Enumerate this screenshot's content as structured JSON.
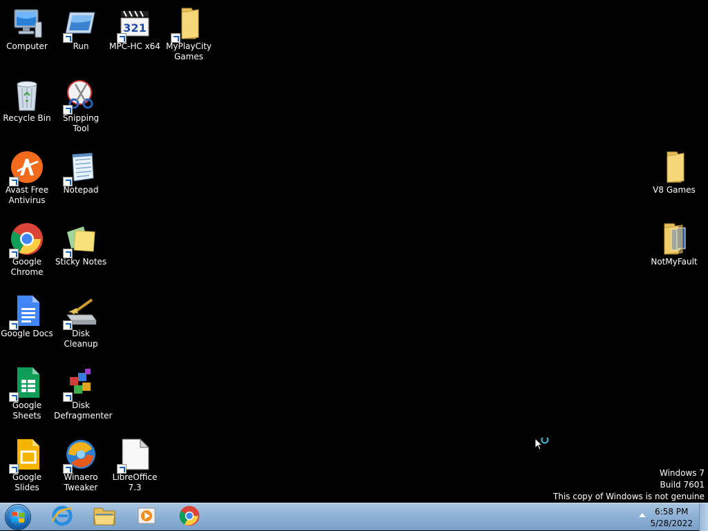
{
  "desktop": {
    "icons": [
      {
        "label": "Computer"
      },
      {
        "label": "Run"
      },
      {
        "label": "MPC-HC x64"
      },
      {
        "label": "MyPlayCity Games"
      },
      {
        "label": "Recycle Bin"
      },
      {
        "label": "Snipping Tool"
      },
      {
        "label": "Avast Free Antivirus"
      },
      {
        "label": "Notepad"
      },
      {
        "label": "Google Chrome"
      },
      {
        "label": "Sticky Notes"
      },
      {
        "label": "Google Docs"
      },
      {
        "label": "Disk Cleanup"
      },
      {
        "label": "Google Sheets"
      },
      {
        "label": "Disk Defragmenter"
      },
      {
        "label": "Google Slides"
      },
      {
        "label": "Winaero Tweaker"
      },
      {
        "label": "LibreOffice 7.3"
      },
      {
        "label": "V8 Games"
      },
      {
        "label": "NotMyFault"
      }
    ]
  },
  "watermark": {
    "line1": "Windows 7",
    "line2": "Build 7601",
    "line3": "This copy of Windows is not genuine"
  },
  "taskbar": {
    "pinned": [
      {
        "icon": "internet-explorer-icon"
      },
      {
        "icon": "windows-explorer-icon"
      },
      {
        "icon": "windows-media-player-icon"
      },
      {
        "icon": "google-chrome-icon"
      }
    ]
  },
  "tray": {
    "time": "6:58 PM",
    "date": "5/28/2022"
  },
  "colors": {
    "desktop_background": "#000000",
    "taskbar": "#8fb2d6"
  }
}
